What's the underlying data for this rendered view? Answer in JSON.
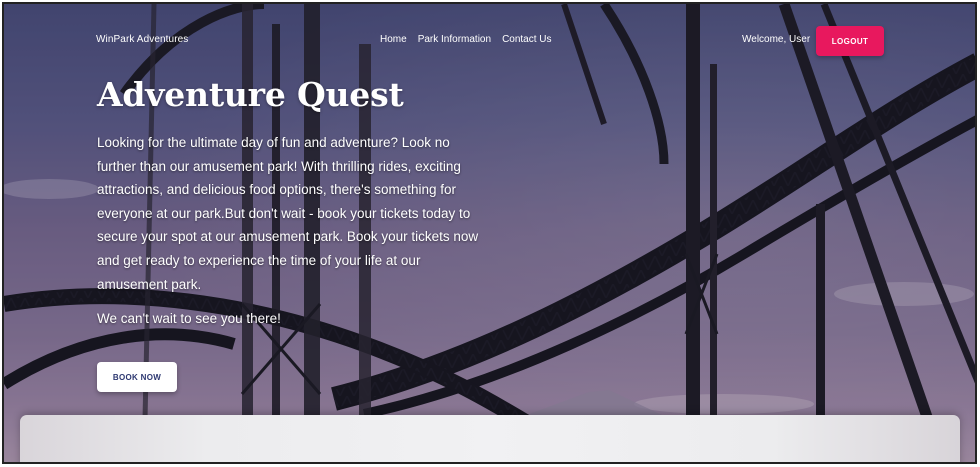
{
  "header": {
    "brand": "WinPark Adventures",
    "nav": [
      {
        "label": "Home"
      },
      {
        "label": "Park Information"
      },
      {
        "label": "Contact Us"
      }
    ],
    "welcome_text": "Welcome, User",
    "logout_label": "LOGOUT"
  },
  "hero": {
    "title": "Adventure Quest",
    "paragraph": "Looking for the ultimate day of fun and adventure? Look no further than our amusement park! With thrilling rides, exciting attractions, and delicious food options, there's something for everyone at our park.But don't wait - book your tickets today to secure your spot at our amusement park. Book your tickets now and get ready to experience the time of your life at our amusement park.",
    "closing": "We can't wait to see you there!",
    "book_label": "BOOK NOW"
  },
  "colors": {
    "accent": "#e8185e",
    "book_button_text": "#2c3770"
  },
  "icons": {
    "background": "roller-coaster-photo"
  }
}
